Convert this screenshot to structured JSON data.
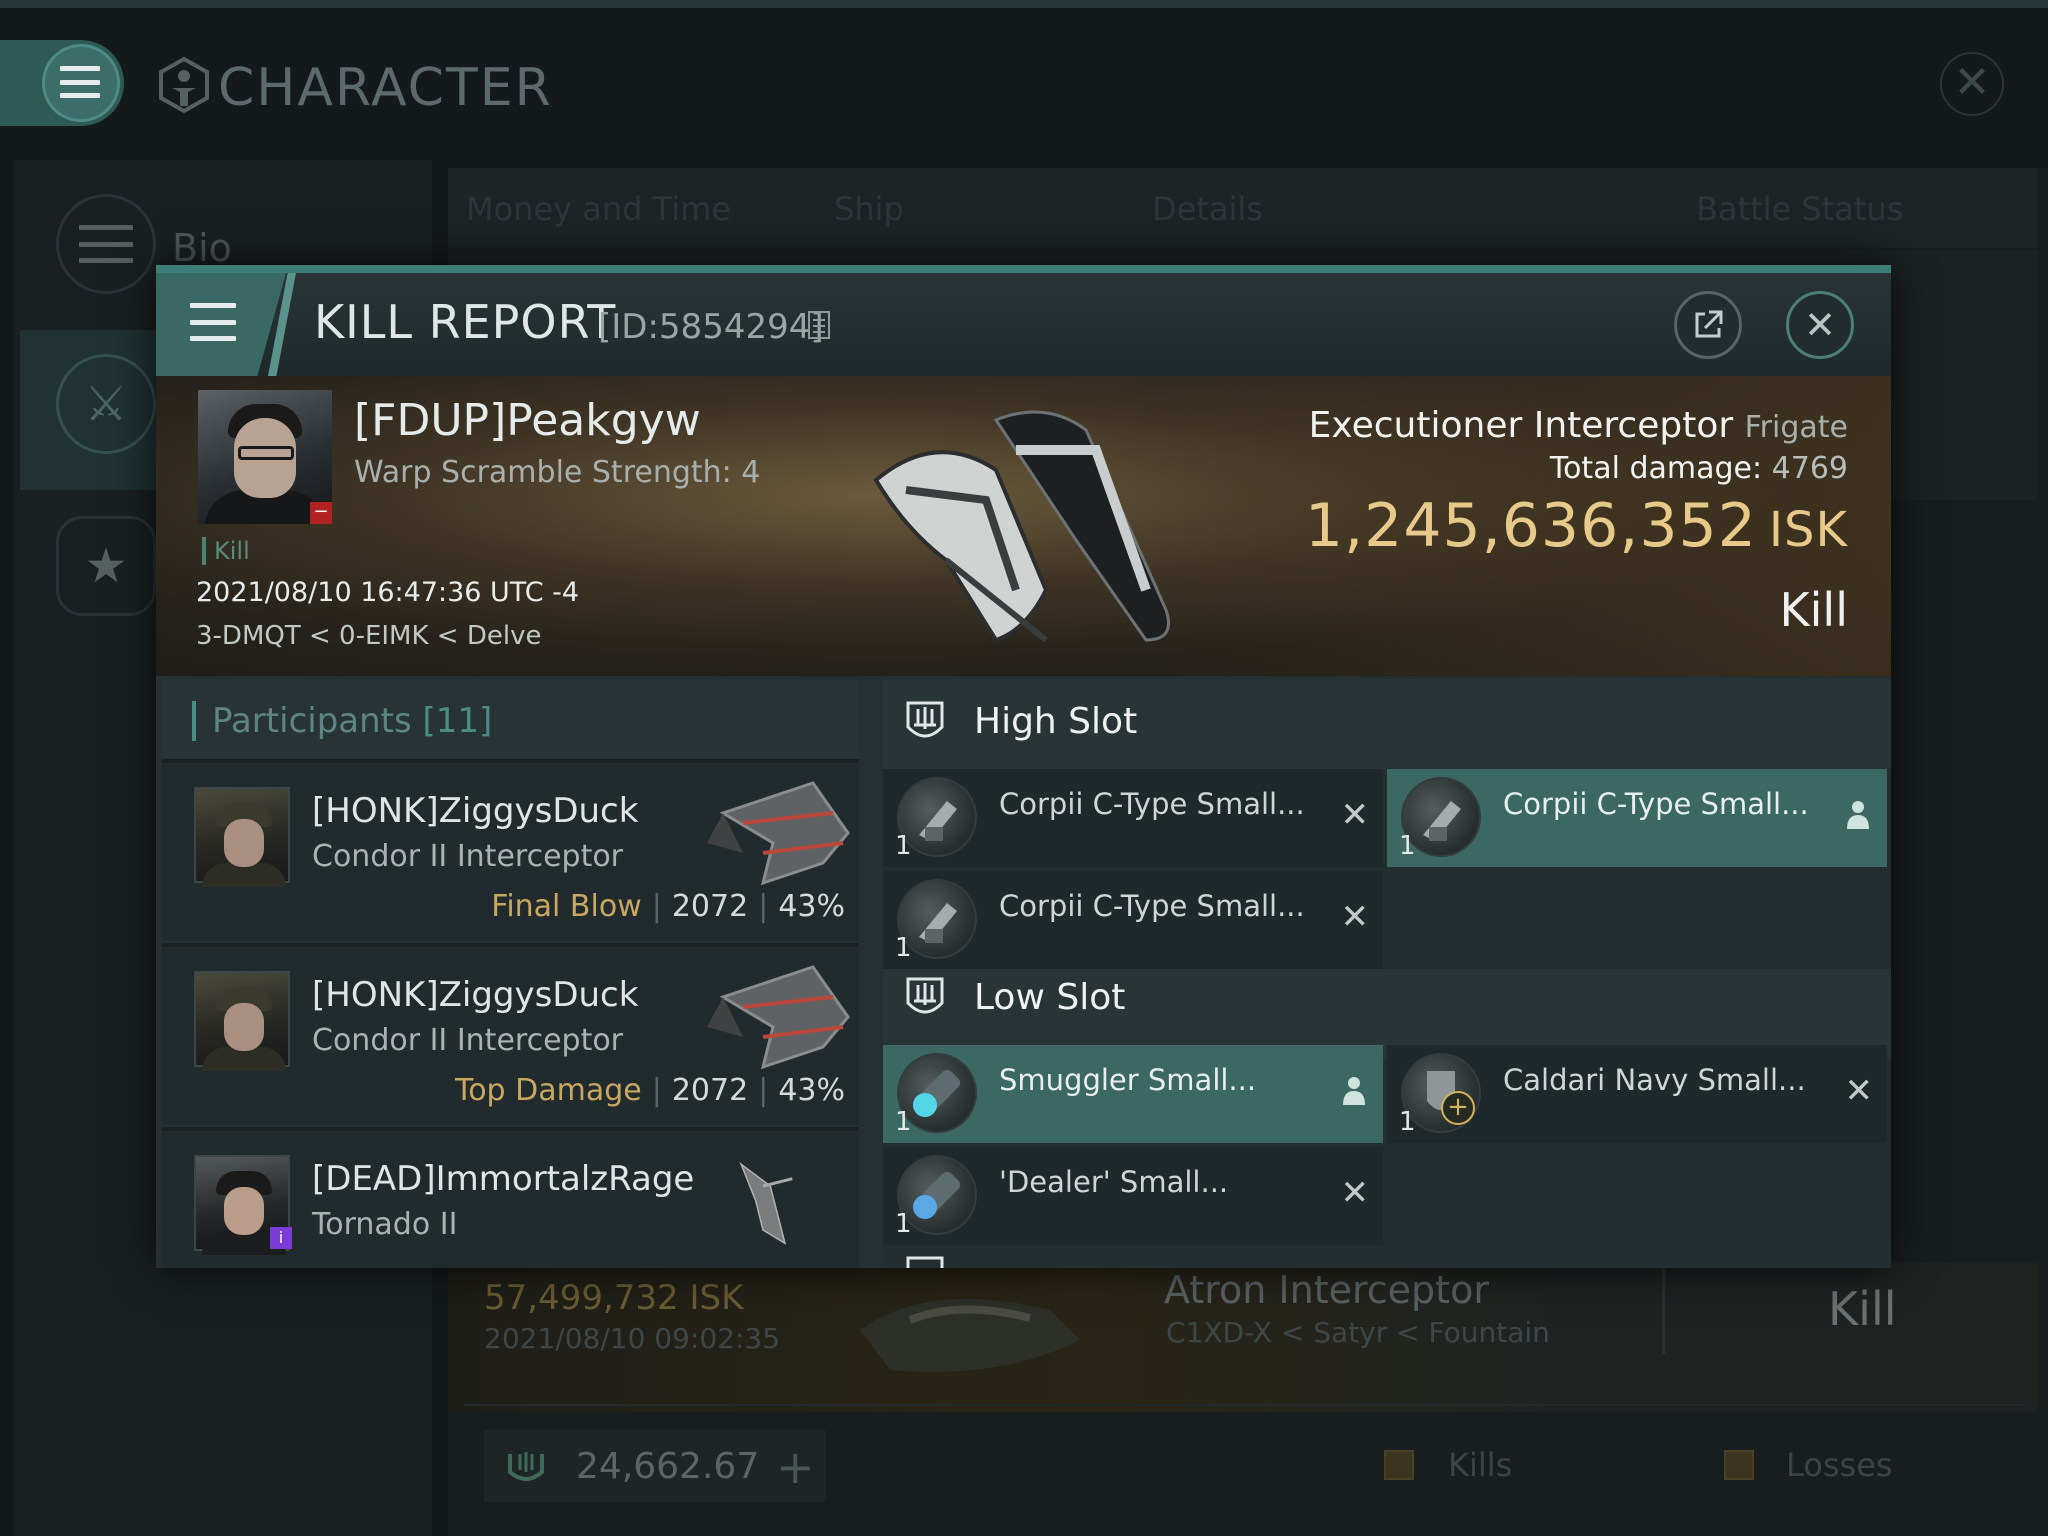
{
  "app": {
    "title": "CHARACTER",
    "side_items": [
      {
        "label": "Bio"
      }
    ],
    "tabs": [
      "Money and Time",
      "Ship",
      "Details",
      "Battle Status"
    ],
    "background_entry": {
      "value": "57,499,732",
      "unit": "ISK",
      "date": "2021/08/10 09:02:35",
      "ship": "Atron Interceptor",
      "location": "C1XD-X < Satyr < Fountain",
      "result": "Kill"
    },
    "wallet": {
      "value": "24,662.67"
    },
    "legend": [
      "Kills",
      "Losses"
    ]
  },
  "report": {
    "title": "KILL REPORT",
    "id_text": "[ID:5854294]",
    "victim": {
      "name": "[FDUP]Peakgyw",
      "warp": "Warp Scramble Strength: 4",
      "tag": "Kill",
      "datetime": "2021/08/10 16:47:36 UTC -4",
      "location": "3-DMQT < 0-EIMK < Delve"
    },
    "ship": {
      "name": "Executioner Interceptor",
      "class": "Frigate",
      "total_damage_label": "Total damage:",
      "total_damage": "4769",
      "isk_value": "1,245,636,352",
      "isk_unit": "ISK",
      "result": "Kill"
    },
    "participants": {
      "label": "Participants",
      "count": "[11]",
      "rows": [
        {
          "name": "[HONK]ZiggysDuck",
          "ship": "Condor II Interceptor",
          "tag": "Final Blow",
          "damage": "2072",
          "percent": "43%"
        },
        {
          "name": "[HONK]ZiggysDuck",
          "ship": "Condor II Interceptor",
          "tag": "Top Damage",
          "damage": "2072",
          "percent": "43%"
        },
        {
          "name": "[DEAD]ImmortalzRage",
          "ship": "Tornado II"
        }
      ]
    },
    "slots": {
      "high": {
        "label": "High Slot",
        "modules": [
          {
            "name": "Corpii C-Type Small...",
            "qty": "1"
          },
          {
            "name": "Corpii C-Type Small...",
            "qty": "1"
          },
          {
            "name": "Corpii C-Type Small...",
            "qty": "1"
          }
        ]
      },
      "low": {
        "label": "Low Slot",
        "modules": [
          {
            "name": "Smuggler Small...",
            "qty": "1"
          },
          {
            "name": "Caldari Navy Small...",
            "qty": "1"
          },
          {
            "name": "'Dealer' Small...",
            "qty": "1"
          }
        ]
      }
    },
    "colors": {
      "accent": "#3f7d77",
      "isk": "#e7c98a",
      "gold_tag": "#c9a760",
      "selected_row": "#3b6863"
    }
  }
}
